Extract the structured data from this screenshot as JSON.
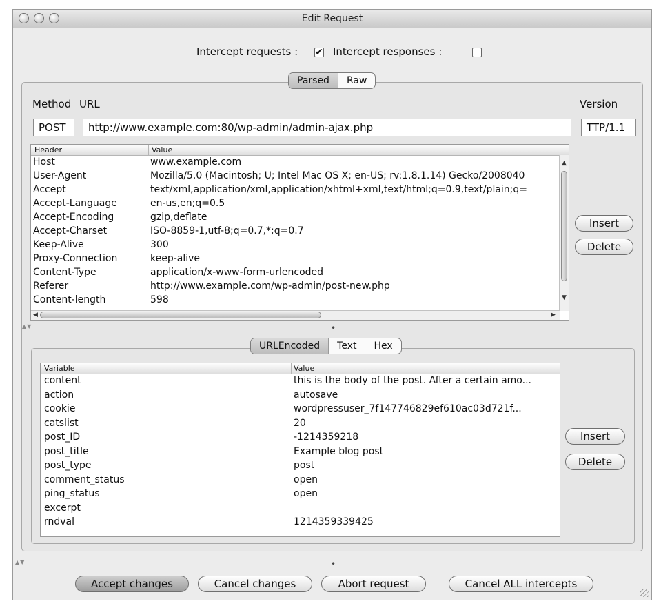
{
  "window": {
    "title": "Edit Request"
  },
  "intercept": {
    "requests_label": "Intercept requests :",
    "requests_checked": true,
    "responses_label": "Intercept responses :",
    "responses_checked": false
  },
  "view_tabs": {
    "parsed": "Parsed",
    "raw": "Raw",
    "selected": "Parsed"
  },
  "request_line": {
    "method_label": "Method",
    "url_label": "URL",
    "version_label": "Version",
    "method": "POST",
    "url": "http://www.example.com:80/wp-admin/admin-ajax.php",
    "version": "TTP/1.1"
  },
  "headers_table": {
    "col_header": "Header",
    "col_value": "Value",
    "rows": [
      {
        "name": "Host",
        "value": "www.example.com"
      },
      {
        "name": "User-Agent",
        "value": "Mozilla/5.0 (Macintosh; U; Intel Mac OS X; en-US; rv:1.8.1.14) Gecko/2008040"
      },
      {
        "name": "Accept",
        "value": "text/xml,application/xml,application/xhtml+xml,text/html;q=0.9,text/plain;q="
      },
      {
        "name": "Accept-Language",
        "value": "en-us,en;q=0.5"
      },
      {
        "name": "Accept-Encoding",
        "value": "gzip,deflate"
      },
      {
        "name": "Accept-Charset",
        "value": "ISO-8859-1,utf-8;q=0.7,*;q=0.7"
      },
      {
        "name": "Keep-Alive",
        "value": "300"
      },
      {
        "name": "Proxy-Connection",
        "value": "keep-alive"
      },
      {
        "name": "Content-Type",
        "value": "application/x-www-form-urlencoded"
      },
      {
        "name": "Referer",
        "value": "http://www.example.com/wp-admin/post-new.php"
      },
      {
        "name": "Content-length",
        "value": "598"
      }
    ],
    "insert_label": "Insert",
    "delete_label": "Delete"
  },
  "body_tabs": {
    "urlencoded": "URLEncoded",
    "text": "Text",
    "hex": "Hex",
    "selected": "URLEncoded"
  },
  "body_table": {
    "col_variable": "Variable",
    "col_value": "Value",
    "rows": [
      {
        "name": "content",
        "value": "this is the body of the post. After a certain amo..."
      },
      {
        "name": "action",
        "value": "autosave"
      },
      {
        "name": "cookie",
        "value": "wordpressuser_7f147746829ef610ac03d721f..."
      },
      {
        "name": "catslist",
        "value": "20"
      },
      {
        "name": "post_ID",
        "value": "-1214359218"
      },
      {
        "name": "post_title",
        "value": "Example blog post"
      },
      {
        "name": "post_type",
        "value": "post"
      },
      {
        "name": "comment_status",
        "value": "open"
      },
      {
        "name": "ping_status",
        "value": "open"
      },
      {
        "name": "excerpt",
        "value": ""
      },
      {
        "name": "rndval",
        "value": "1214359339425"
      }
    ],
    "insert_label": "Insert",
    "delete_label": "Delete"
  },
  "footer": {
    "accept": "Accept changes",
    "cancel": "Cancel changes",
    "abort": "Abort request",
    "cancel_all": "Cancel ALL intercepts"
  },
  "glyphs": {
    "check": "✔"
  }
}
